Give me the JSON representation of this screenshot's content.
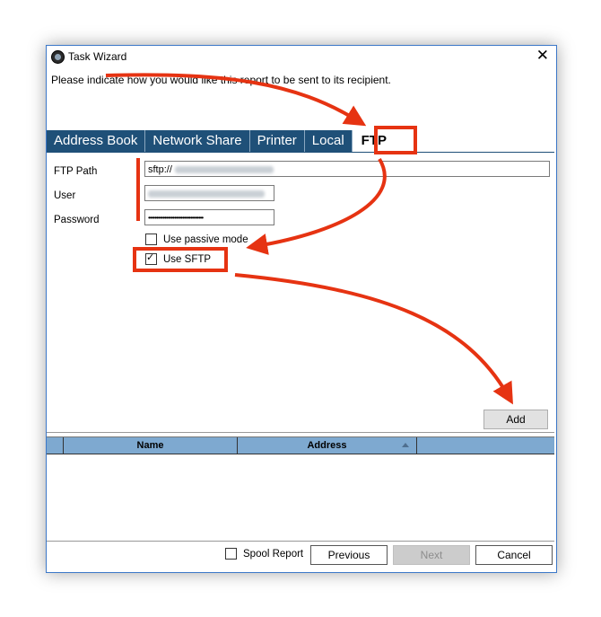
{
  "window": {
    "title": "Task Wizard",
    "close_glyph": "✕",
    "instruction": "Please indicate how you would like this report to be sent to its recipient."
  },
  "tabs": [
    {
      "label": "Address Book",
      "active": false
    },
    {
      "label": "Network Share",
      "active": false
    },
    {
      "label": "Printer",
      "active": false
    },
    {
      "label": "Local",
      "active": false
    },
    {
      "label": "FTP",
      "active": true
    }
  ],
  "ftp": {
    "path_label": "FTP Path",
    "path_value": "sftp://",
    "user_label": "User",
    "password_label": "Password",
    "password_value": "••••••••••••••••••••••••••••••••••",
    "passive_label": "Use passive mode",
    "passive_checked": false,
    "sftp_label": "Use SFTP",
    "sftp_checked": true,
    "add_label": "Add"
  },
  "grid": {
    "columns": [
      "Name",
      "Address"
    ]
  },
  "footer": {
    "spool_label": "Spool Report",
    "spool_checked": false,
    "previous_label": "Previous",
    "next_label": "Next",
    "cancel_label": "Cancel"
  },
  "colors": {
    "accent": "#1f5078",
    "annotation": "#e63312",
    "grid_header": "#7ea9d0"
  },
  "icons": [
    "app-icon",
    "close-icon",
    "sort-ascending-icon",
    "checkmark-icon"
  ]
}
